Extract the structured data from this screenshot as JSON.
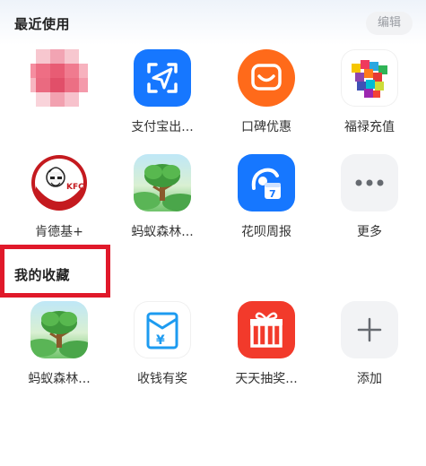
{
  "recent": {
    "title": "最近使用",
    "edit_label": "编辑",
    "apps": [
      {
        "label": "",
        "icon": "blurred-avatar"
      },
      {
        "label": "支付宝出...",
        "icon": "scan-send-icon"
      },
      {
        "label": "口碑优惠",
        "icon": "koubei-smile-icon"
      },
      {
        "label": "福禄充值",
        "icon": "fulu-cubes-icon"
      },
      {
        "label": "肯德基+",
        "icon": "kfc-logo-icon"
      },
      {
        "label": "蚂蚁森林...",
        "icon": "ant-forest-tree-icon"
      },
      {
        "label": "花呗周报",
        "icon": "huabei-weekly-icon"
      },
      {
        "label": "更多",
        "icon": "more-dots-icon"
      }
    ]
  },
  "favorites": {
    "title": "我的收藏",
    "apps": [
      {
        "label": "蚂蚁森林...",
        "icon": "ant-forest-tree-icon"
      },
      {
        "label": "收钱有奖",
        "icon": "collect-money-icon"
      },
      {
        "label": "天天抽奖...",
        "icon": "gift-box-icon"
      },
      {
        "label": "添加",
        "icon": "plus-icon"
      }
    ]
  },
  "colors": {
    "alipay_blue": "#1677ff",
    "koubei_orange": "#ff6a1a",
    "highlight_red": "#e0192a"
  }
}
